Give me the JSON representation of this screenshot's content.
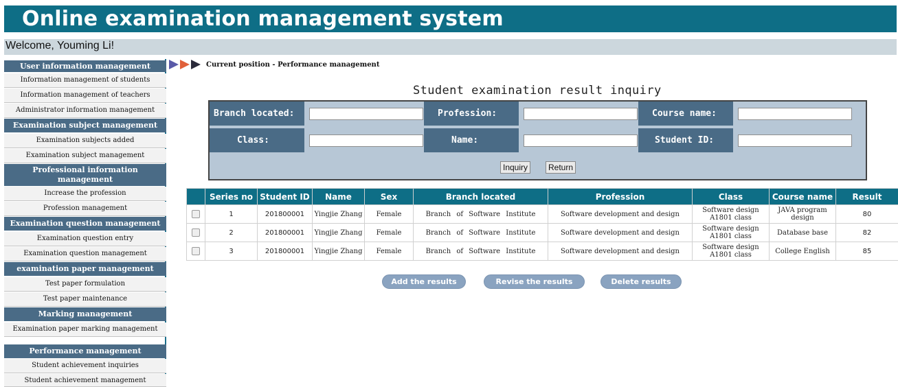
{
  "header": {
    "title": "Online examination management system"
  },
  "welcome": {
    "text": "Welcome, Youming Li!"
  },
  "sidebar": {
    "sections": [
      {
        "title": "User information management",
        "items": [
          "Information management of students",
          "Information management of teachers",
          "Administrator information management"
        ]
      },
      {
        "title": "Examination subject management",
        "items": [
          "Examination subjects added",
          "Examination subject management"
        ]
      },
      {
        "title": "Professional information management",
        "items": [
          "Increase the profession",
          "Profession management"
        ]
      },
      {
        "title": "Examination question management",
        "items": [
          "Examination question entry",
          "Examination question management"
        ]
      },
      {
        "title": "examination paper management",
        "items": [
          "Test paper formulation",
          "Test paper maintenance"
        ]
      },
      {
        "title": "Marking management",
        "items": [
          "Examination paper marking management"
        ]
      },
      {
        "title": "Performance management",
        "items": [
          "Student achievement inquiries",
          "Student achievement management"
        ]
      }
    ]
  },
  "breadcrumb": {
    "text": "Current position - Performance management"
  },
  "page_title": "Student examination result inquiry",
  "search": {
    "branch_label": "Branch located:",
    "profession_label": "Profession:",
    "course_label": "Course name:",
    "class_label": "Class:",
    "name_label": "Name:",
    "student_id_label": "Student ID:",
    "inquiry_button": "Inquiry",
    "return_button": "Return"
  },
  "table": {
    "columns": [
      "Series no",
      "Student ID",
      "Name",
      "Sex",
      "Branch located",
      "Profession",
      "Class",
      "Course name",
      "Result"
    ],
    "rows": [
      {
        "series": "1",
        "student_id": "201800001",
        "name": "Yingjie Zhang",
        "sex": "Female",
        "branch": "Branch of Software Institute",
        "profession": "Software development and design",
        "class": "Software design A1801 class",
        "course": "JAVA program design",
        "result": "80"
      },
      {
        "series": "2",
        "student_id": "201800001",
        "name": "Yingjie Zhang",
        "sex": "Female",
        "branch": "Branch of Software Institute",
        "profession": "Software development and design",
        "class": "Software design A1801 class",
        "course": "Database base",
        "result": "82"
      },
      {
        "series": "3",
        "student_id": "201800001",
        "name": "Yingjie Zhang",
        "sex": "Female",
        "branch": "Branch of Software Institute",
        "profession": "Software development and design",
        "class": "Software design A1801 class",
        "course": "College English",
        "result": "85"
      }
    ]
  },
  "actions": {
    "add": "Add the results",
    "revise": "Revise the results",
    "delete": "Delete results"
  },
  "colors": {
    "header_bg": "#0e6e86",
    "section_bg": "#4a6b86",
    "search_bg": "#b7c7d6",
    "action_button": "#8aa3c0"
  },
  "icons": {
    "breadcrumb": "triple-arrow-icon"
  }
}
